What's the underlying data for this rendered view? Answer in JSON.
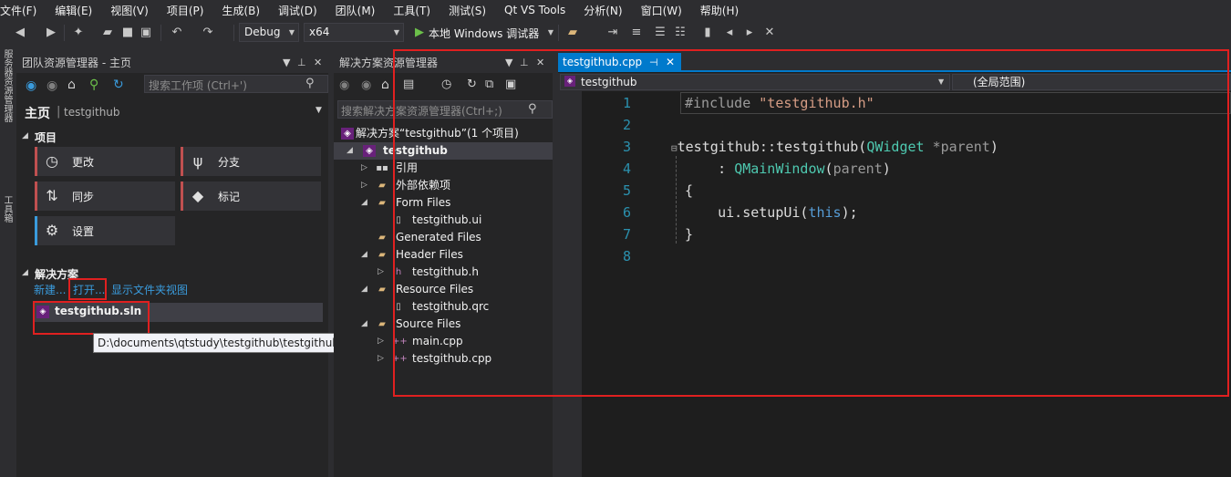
{
  "menu": [
    "文件(F)",
    "编辑(E)",
    "视图(V)",
    "项目(P)",
    "生成(B)",
    "调试(D)",
    "团队(M)",
    "工具(T)",
    "测试(S)",
    "Qt VS Tools",
    "分析(N)",
    "窗口(W)",
    "帮助(H)"
  ],
  "toolbar": {
    "config": "Debug",
    "platform": "x64",
    "run_label": "本地 Windows 调试器"
  },
  "side_strip": {
    "server": "服务器资源管理器",
    "toolbox": "工具箱"
  },
  "team": {
    "title": "团队资源管理器 - 主页",
    "search_placeholder": "搜索工作项 (Ctrl+')",
    "home": "主页",
    "repo": "testgithub",
    "projects_section": "项目",
    "tiles": [
      "更改",
      "分支",
      "同步",
      "标记",
      "设置"
    ],
    "solutions_section": "解决方案",
    "link_new": "新建...",
    "link_open": "打开...",
    "link_folder": "显示文件夹视图",
    "solution_file": "testgithub.sln",
    "tooltip": "D:\\documents\\qtstudy\\testgithub\\testgithub.sln"
  },
  "solution_explorer": {
    "title": "解决方案资源管理器",
    "search_placeholder": "搜索解决方案资源管理器(Ctrl+;)",
    "root": "解决方案“testgithub”(1 个项目)",
    "project": "testgithub",
    "items": [
      {
        "label": "引用",
        "indent": 1,
        "expander": "▷",
        "icon": "references-icon"
      },
      {
        "label": "外部依赖项",
        "indent": 1,
        "expander": "▷",
        "icon": "external-deps-icon"
      },
      {
        "label": "Form Files",
        "indent": 1,
        "expander": "◢",
        "icon": "folder-icon"
      },
      {
        "label": "testgithub.ui",
        "indent": 2,
        "expander": "",
        "icon": "ui-file-icon"
      },
      {
        "label": "Generated Files",
        "indent": 1,
        "expander": "",
        "icon": "folder-icon"
      },
      {
        "label": "Header Files",
        "indent": 1,
        "expander": "◢",
        "icon": "folder-icon"
      },
      {
        "label": "testgithub.h",
        "indent": 2,
        "expander": "▷",
        "icon": "header-file-icon"
      },
      {
        "label": "Resource Files",
        "indent": 1,
        "expander": "◢",
        "icon": "folder-icon"
      },
      {
        "label": "testgithub.qrc",
        "indent": 2,
        "expander": "",
        "icon": "resource-file-icon"
      },
      {
        "label": "Source Files",
        "indent": 1,
        "expander": "◢",
        "icon": "folder-icon"
      },
      {
        "label": "main.cpp",
        "indent": 2,
        "expander": "▷",
        "icon": "cpp-file-icon"
      },
      {
        "label": "testgithub.cpp",
        "indent": 2,
        "expander": "▷",
        "icon": "cpp-file-icon"
      }
    ]
  },
  "editor": {
    "tab": "testgithub.cpp",
    "nav_left": "testgithub",
    "nav_right": "(全局范围)",
    "line_numbers": [
      "1",
      "2",
      "3",
      "4",
      "5",
      "6",
      "7",
      "8"
    ]
  }
}
